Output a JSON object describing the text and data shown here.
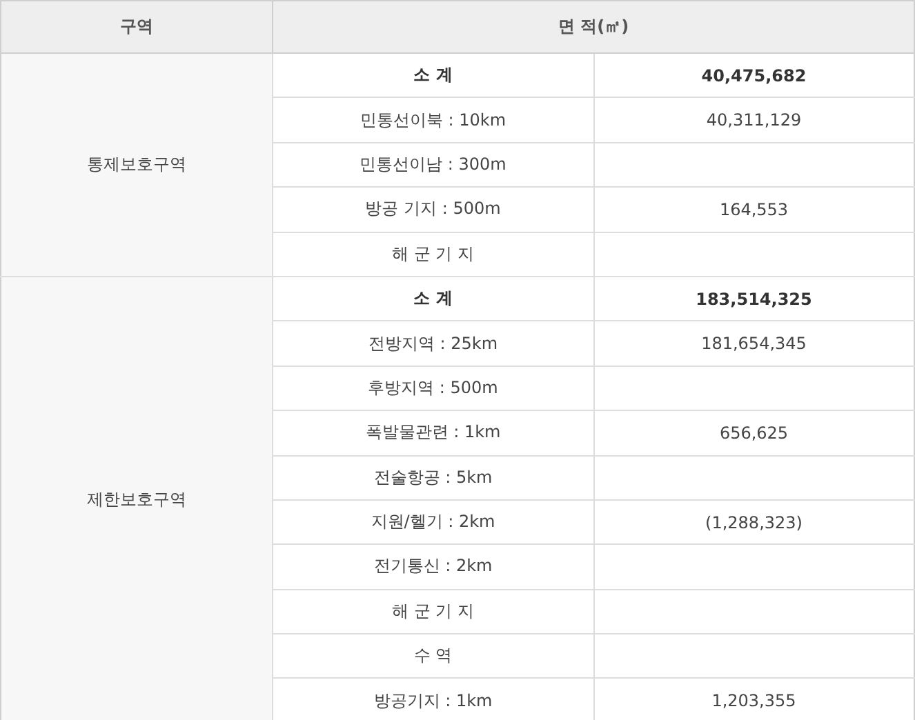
{
  "table": {
    "columns": [
      "구역",
      "면 적(㎡)"
    ],
    "groups": [
      {
        "zone": "통제보호구역",
        "rows": [
          {
            "kind": "subtotal",
            "label": "소 계",
            "area": "40,475,682"
          },
          {
            "kind": "item",
            "label": "민통선이북 : 10km",
            "area": "40,311,129"
          },
          {
            "kind": "item",
            "label": "민통선이남 : 300m",
            "area": ""
          },
          {
            "kind": "item",
            "label": "방공 기지 : 500m",
            "area": "164,553"
          },
          {
            "kind": "item",
            "label": "해 군 기 지",
            "area": ""
          }
        ]
      },
      {
        "zone": "제한보호구역",
        "rows": [
          {
            "kind": "subtotal",
            "label": "소 계",
            "area": "183,514,325"
          },
          {
            "kind": "item",
            "label": "전방지역 : 25km",
            "area": "181,654,345"
          },
          {
            "kind": "item",
            "label": "후방지역 : 500m",
            "area": ""
          },
          {
            "kind": "item",
            "label": "폭발물관련 : 1km",
            "area": "656,625"
          },
          {
            "kind": "item",
            "label": "전술항공 : 5km",
            "area": ""
          },
          {
            "kind": "item",
            "label": "지원/헬기 : 2km",
            "area": "(1,288,323)"
          },
          {
            "kind": "item",
            "label": "전기통신 : 2km",
            "area": ""
          },
          {
            "kind": "item",
            "label": "해 군 기 지",
            "area": ""
          },
          {
            "kind": "item",
            "label": "수 역",
            "area": ""
          },
          {
            "kind": "item",
            "label": "방공기지 : 1km",
            "area": "1,203,355"
          }
        ]
      }
    ]
  }
}
